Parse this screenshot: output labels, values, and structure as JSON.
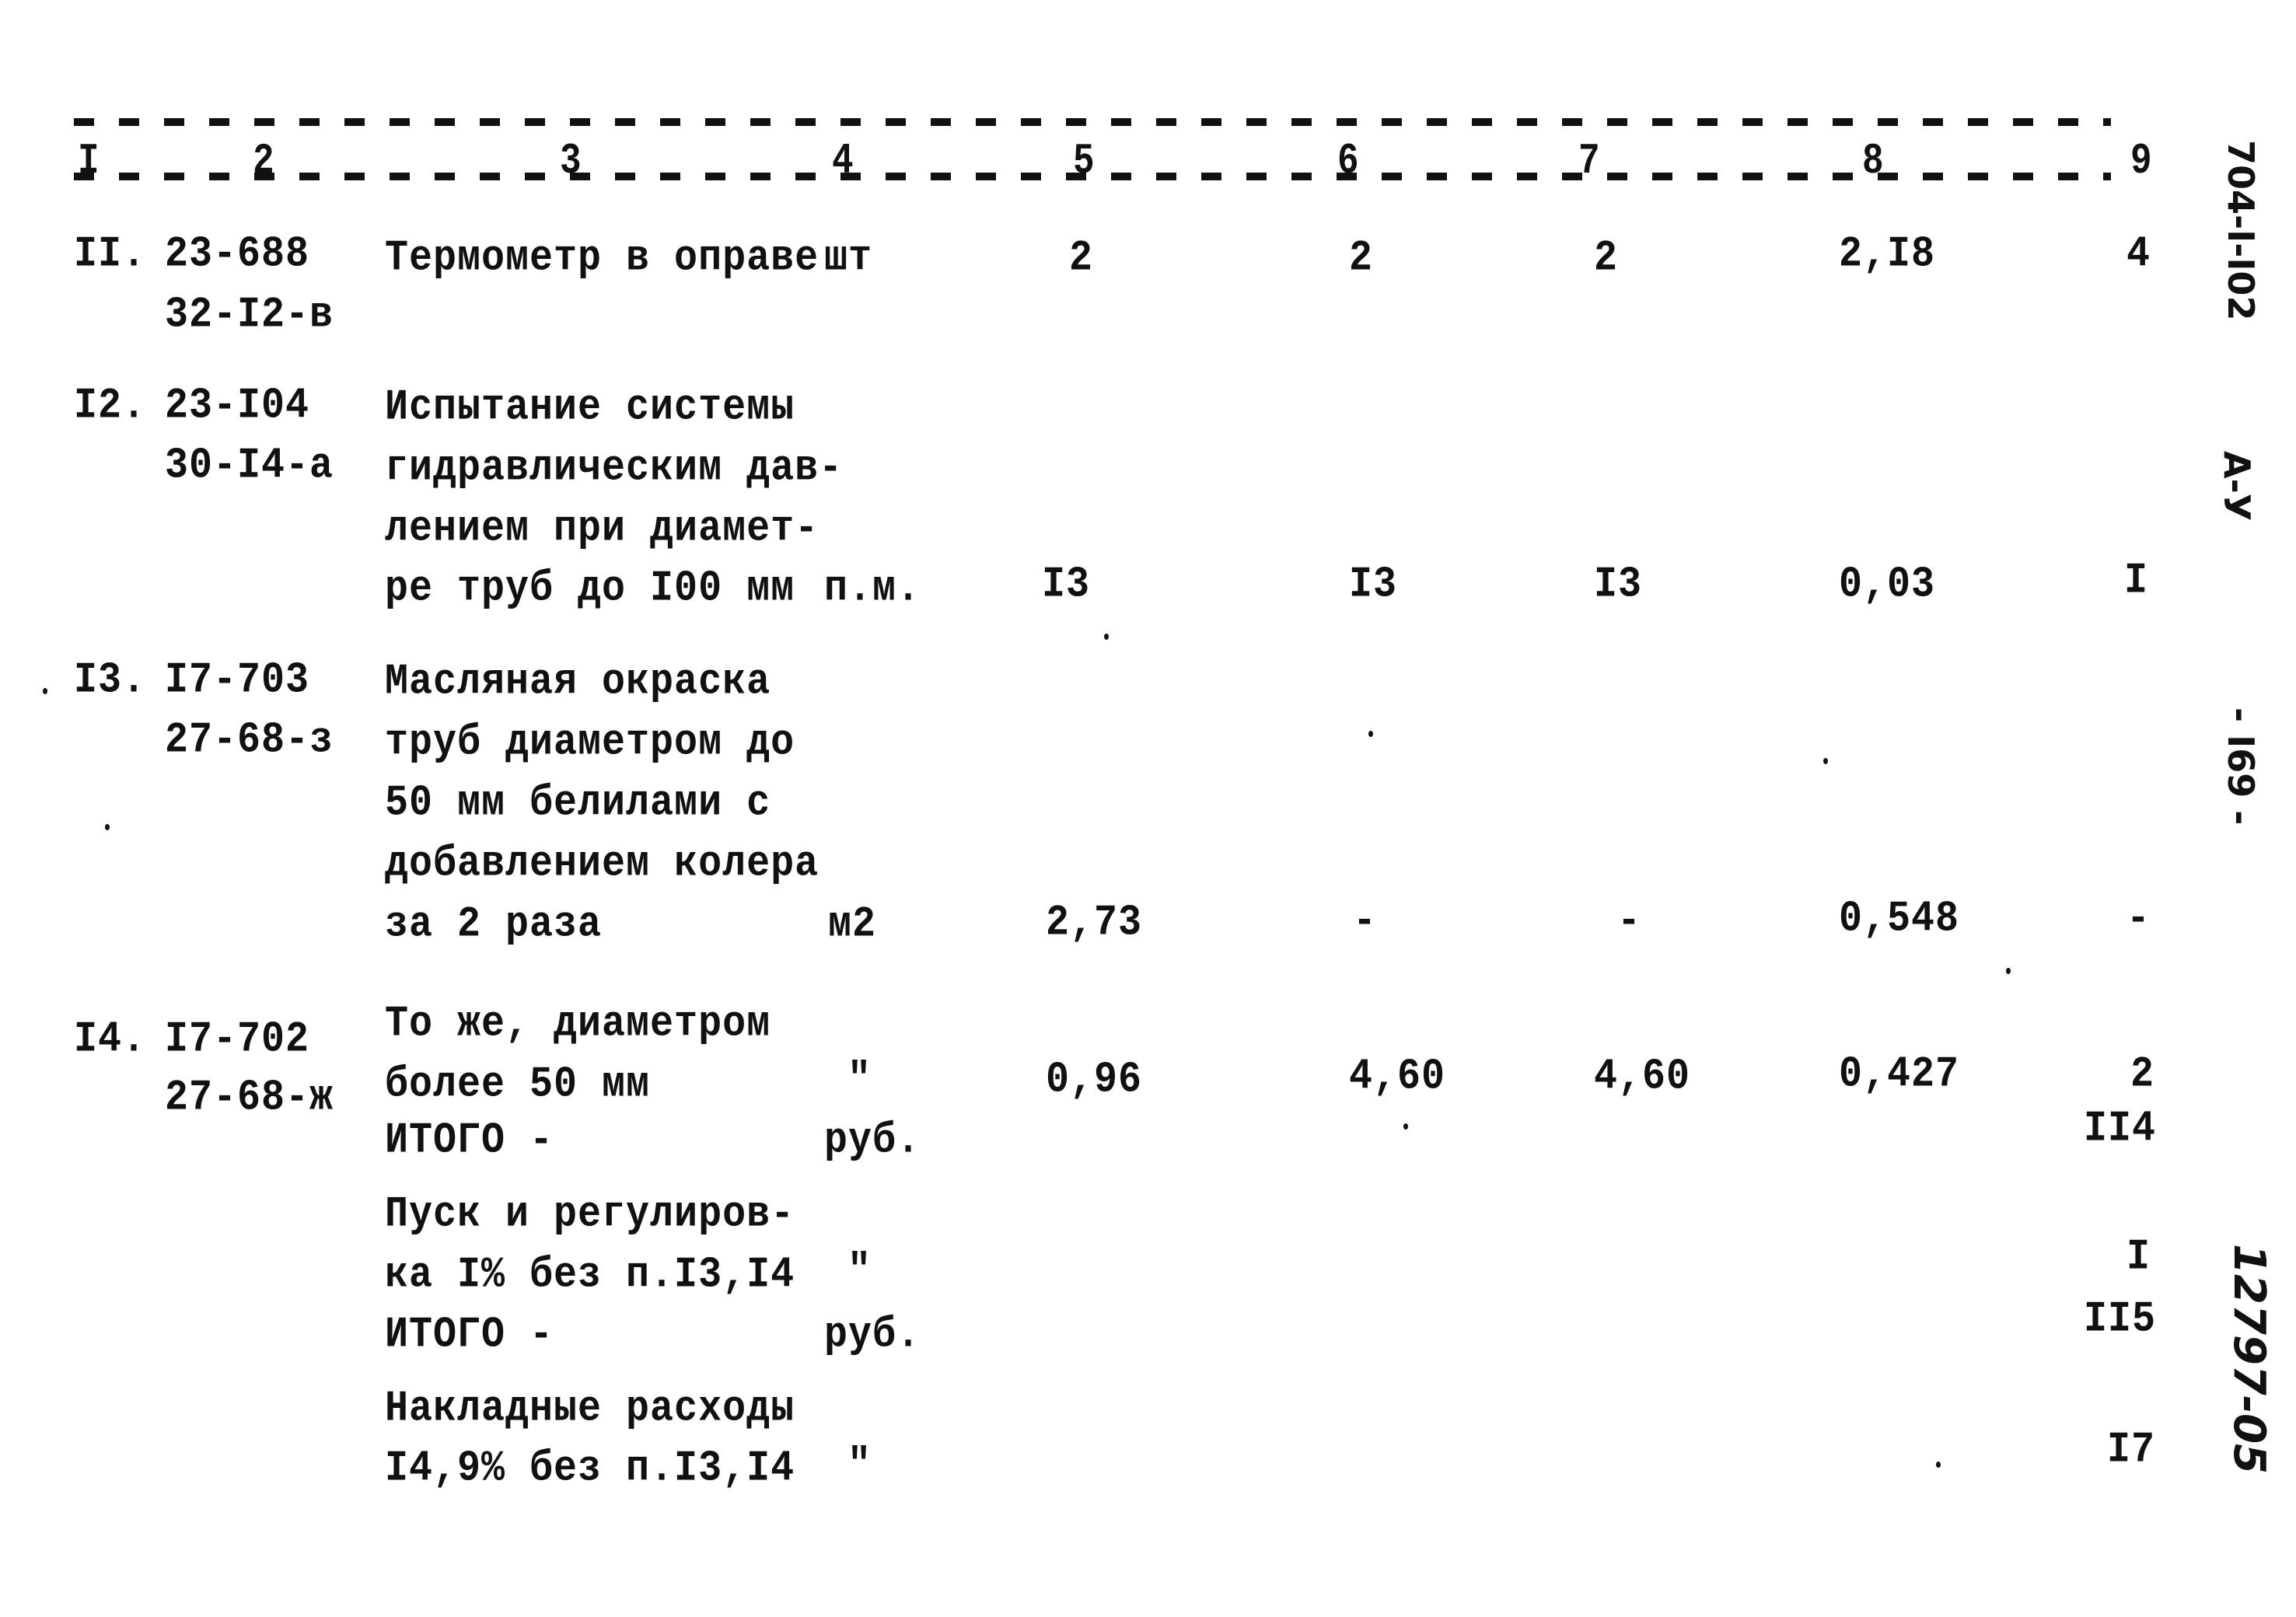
{
  "header": {
    "columns": [
      "I",
      "2",
      "3",
      "4",
      "5",
      "6",
      "7",
      "8",
      "9"
    ]
  },
  "rows": [
    {
      "num": "II.",
      "code1": "23-688",
      "code2": "32-I2-в",
      "name_lines": [
        "Термометр в оправе"
      ],
      "unit": "шт",
      "c5": "2",
      "c6": "2",
      "c7": "2",
      "c8": "2,I8",
      "c9": "4"
    },
    {
      "num": "I2.",
      "code1": "23-I04",
      "code2": "30-I4-а",
      "name_lines": [
        "Испытание системы",
        "гидравлическим дав-",
        "лением при диамет-",
        "ре труб до I00 мм"
      ],
      "unit": "п.м.",
      "c5": "I3",
      "c6": "I3",
      "c7": "I3",
      "c8": "0,03",
      "c9": "I"
    },
    {
      "num": "I3.",
      "code1": "I7-703",
      "code2": "27-68-з",
      "name_lines": [
        "Масляная окраска",
        "труб диаметром до",
        "50 мм белилами с",
        "добавлением колера",
        "за 2 раза"
      ],
      "unit": "м2",
      "c5": "2,73",
      "c6": "-",
      "c7": "-",
      "c8": "0,548",
      "c9": "-"
    },
    {
      "num": "I4.",
      "code1": "I7-702",
      "code2": "27-68-ж",
      "name_lines": [
        "То же, диаметром",
        "более 50 мм"
      ],
      "unit": "\"",
      "c5": "0,96",
      "c6": "4,60",
      "c7": "4,60",
      "c8": "0,427",
      "c9": "2"
    }
  ],
  "summary": [
    {
      "label_lines": [
        "ИТОГО -"
      ],
      "unit": "руб.",
      "c9": "II4"
    },
    {
      "label_lines": [
        "Пуск и регулиров-",
        "ка I% без п.I3,I4"
      ],
      "unit": "\"",
      "c9": "I"
    },
    {
      "label_lines": [
        "ИТОГО -"
      ],
      "unit": "руб.",
      "c9": "II5"
    },
    {
      "label_lines": [
        "Накладные расходы",
        "I4,9% без п.I3,I4"
      ],
      "unit": "\"",
      "c9": "I7"
    }
  ],
  "margin": {
    "doc_code": "704-I-I02",
    "album": "А-У",
    "page_number": "- I69 -",
    "handwritten_code": "12797-05"
  }
}
